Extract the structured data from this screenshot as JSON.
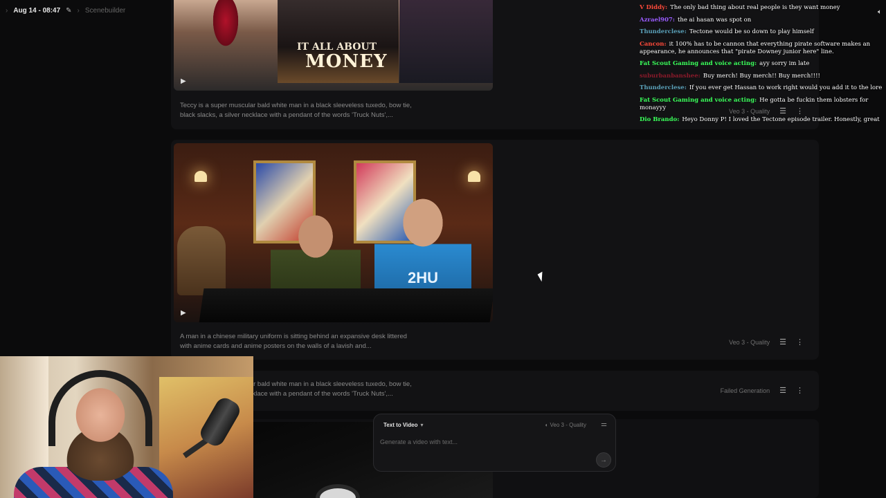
{
  "breadcrumb": {
    "session": "Aug 14 - 08:47",
    "project": "Scenebuilder"
  },
  "cards": [
    {
      "poster_line1": "IT ALL ABOUT",
      "poster_line2": "MONEY",
      "caption": "Teccy is a super muscular bald white man in a black sleeveless tuxedo, bow tie, black slacks, a silver necklace with a pendant of the words 'Truck Nuts',...",
      "model": "Veo 3 - Quality"
    },
    {
      "shirt_text": "2HU",
      "caption": "A man in a chinese military uniform is sitting behind an expansive desk littered with anime cards and anime posters on the walls of a lavish and...",
      "model": "Veo 3 - Quality"
    },
    {
      "caption": "Teccy is a super muscular bald white man in a black sleeveless tuxedo, bow tie, black slacks, a silver necklace with a pendant of the words 'Truck Nuts',...",
      "status": "Failed Generation"
    }
  ],
  "composer": {
    "mode": "Text to Video",
    "model": "Veo 3 - Quality",
    "placeholder": "Generate a video with text..."
  },
  "chat": [
    {
      "user": "V Diddy",
      "color": "#ff4a3a",
      "text": "The only bad thing about real people is they want money"
    },
    {
      "user": "Azrael907",
      "color": "#9a5cff",
      "text": "the ai hasan was spot on"
    },
    {
      "user": "Thunderclese",
      "color": "#5aa0b8",
      "text": "Tectone would be so down to play himself"
    },
    {
      "user": "Cancon",
      "color": "#ff4a3a",
      "text": "it 100% has to be cannon that everything pirate software makes an appearance, he announces that \"pirate Downey junior here\" line."
    },
    {
      "user": "Fat Scout Gaming and voice acting",
      "color": "#3aff5a",
      "text": "ayy sorry im late"
    },
    {
      "user": "suburbanbanshee",
      "color": "#8a1a2a",
      "text": "Buy merch! Buy merch!! Buy merch!!!!"
    },
    {
      "user": "Thunderclese",
      "color": "#5aa0b8",
      "text": "If you ever get Hassan to work right would you add it to the lore"
    },
    {
      "user": "Fat Scout Gaming and voice acting",
      "color": "#3aff5a",
      "text": "He gotta be fuckin them lobsters for monayyy"
    },
    {
      "user": "Dio Brando",
      "color": "#3aff5a",
      "text": "Heyo Donny P! I loved the Tectone episode trailer. Honestly, great"
    }
  ]
}
